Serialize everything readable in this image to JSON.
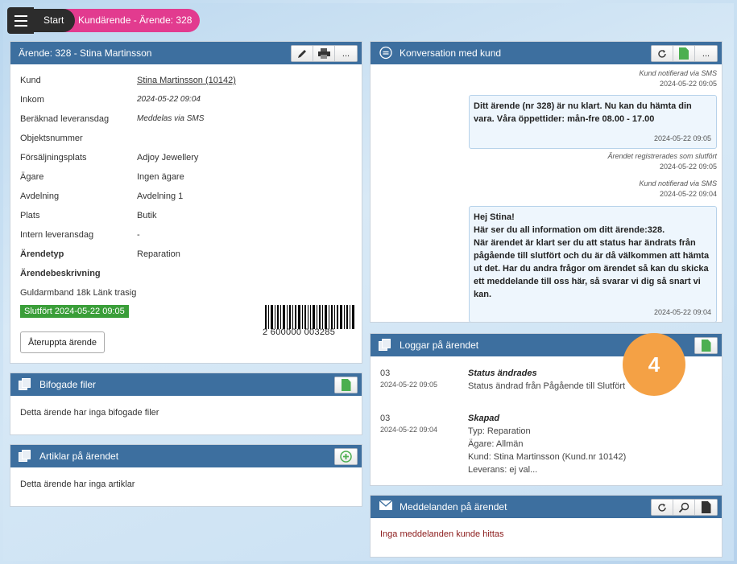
{
  "nav": {
    "start": "Start",
    "current": "Kundärende - Ärende: 328"
  },
  "case_panel": {
    "title": "Ärende: 328 - Stina Martinsson",
    "tool_more": "...",
    "rows": [
      {
        "label": "Kund",
        "value": "Stina Martinsson (10142)"
      },
      {
        "label": "Inkom",
        "value": "2024-05-22 09:04"
      },
      {
        "label": "Beräknad leveransdag",
        "value": "Meddelas via SMS"
      },
      {
        "label": "Objektsnummer",
        "value": ""
      },
      {
        "label": "Försäljningsplats",
        "value": "Adjoy Jewellery"
      },
      {
        "label": "Ägare",
        "value": "Ingen ägare"
      },
      {
        "label": "Avdelning",
        "value": "Avdelning 1"
      },
      {
        "label": "Plats",
        "value": "Butik"
      },
      {
        "label": "Intern leveransdag",
        "value": "-"
      },
      {
        "label": "Ärendetyp",
        "value": "Reparation"
      }
    ],
    "description_label": "Ärendebeskrivning",
    "description": "Guldarmband 18k Länk trasig",
    "status": "Slutfört 2024-05-22 09:05",
    "barcode_number": "2 600000 003285",
    "reopen_button": "Återuppta ärende"
  },
  "files_panel": {
    "title": "Bifogade filer",
    "empty": "Detta ärende har inga bifogade filer"
  },
  "articles_panel": {
    "title": "Artiklar på ärendet",
    "empty": "Detta ärende har inga artiklar"
  },
  "conversation_panel": {
    "title": "Konversation med kund",
    "tool_more": "...",
    "notes": [
      {
        "text": "Kund notifierad via SMS",
        "time": "2024-05-22 09:05"
      },
      {
        "text": "Ärendet registrerades som slutfört",
        "time": "2024-05-22 09:05"
      },
      {
        "text": "Kund notifierad via SMS",
        "time": "2024-05-22 09:04"
      }
    ],
    "messages": [
      {
        "lines": [
          "Ditt ärende (nr 328) är nu klart. Nu kan du hämta din",
          "vara. Våra öppettider: mån-fre 08.00 - 17.00"
        ],
        "time": "2024-05-22 09:05"
      },
      {
        "lines": [
          "Hej Stina!",
          "Här ser du all information om ditt ärende:328.",
          "När ärendet är klart ser du att status har ändrats från",
          "pågående till slutfört och du är då välkommen att hämta",
          "ut det. Har du andra frågor om ärendet så kan du skicka",
          "ett meddelande till oss här, så svarar vi dig så snart vi",
          "kan."
        ],
        "time": "2024-05-22 09:04"
      }
    ]
  },
  "logs_panel": {
    "title": "Loggar på ärendet",
    "entries": [
      {
        "num": "03",
        "date": "2024-05-22 09:05",
        "title": "Status ändrades",
        "lines": [
          "Status ändrad från Pågående till Slutfört"
        ]
      },
      {
        "num": "03",
        "date": "2024-05-22 09:04",
        "title": "Skapad",
        "lines": [
          "Typ: Reparation",
          "Ägare: Allmän",
          "Kund: Stina Martinsson (Kund.nr 10142)",
          "Leverans: ej val..."
        ]
      }
    ]
  },
  "messages_panel": {
    "title": "Meddelanden på ärendet",
    "empty": "Inga meddelanden kunde hittas"
  },
  "overlay_badge": "4",
  "colors": {
    "panel_header": "#3d6f9f",
    "accent_pink": "#e23b8f",
    "status_green": "#3a9e39",
    "badge_orange": "#f4a145"
  }
}
